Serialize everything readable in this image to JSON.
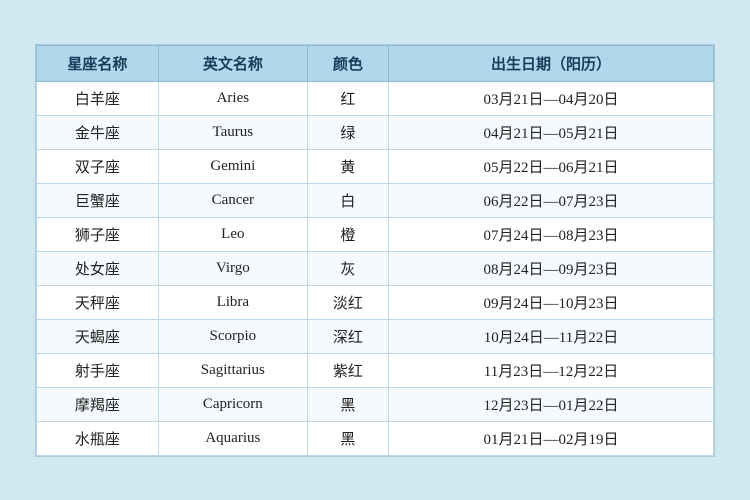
{
  "table": {
    "headers": [
      "星座名称",
      "英文名称",
      "颜色",
      "出生日期（阳历）"
    ],
    "rows": [
      {
        "cn": "白羊座",
        "en": "Aries",
        "color": "红",
        "date": "03月21日—04月20日"
      },
      {
        "cn": "金牛座",
        "en": "Taurus",
        "color": "绿",
        "date": "04月21日—05月21日"
      },
      {
        "cn": "双子座",
        "en": "Gemini",
        "color": "黄",
        "date": "05月22日—06月21日"
      },
      {
        "cn": "巨蟹座",
        "en": "Cancer",
        "color": "白",
        "date": "06月22日—07月23日"
      },
      {
        "cn": "狮子座",
        "en": "Leo",
        "color": "橙",
        "date": "07月24日—08月23日"
      },
      {
        "cn": "处女座",
        "en": "Virgo",
        "color": "灰",
        "date": "08月24日—09月23日"
      },
      {
        "cn": "天秤座",
        "en": "Libra",
        "color": "淡红",
        "date": "09月24日—10月23日"
      },
      {
        "cn": "天蝎座",
        "en": "Scorpio",
        "color": "深红",
        "date": "10月24日—11月22日"
      },
      {
        "cn": "射手座",
        "en": "Sagittarius",
        "color": "紫红",
        "date": "11月23日—12月22日"
      },
      {
        "cn": "摩羯座",
        "en": "Capricorn",
        "color": "黑",
        "date": "12月23日—01月22日"
      },
      {
        "cn": "水瓶座",
        "en": "Aquarius",
        "color": "黑",
        "date": "01月21日—02月19日"
      }
    ]
  }
}
